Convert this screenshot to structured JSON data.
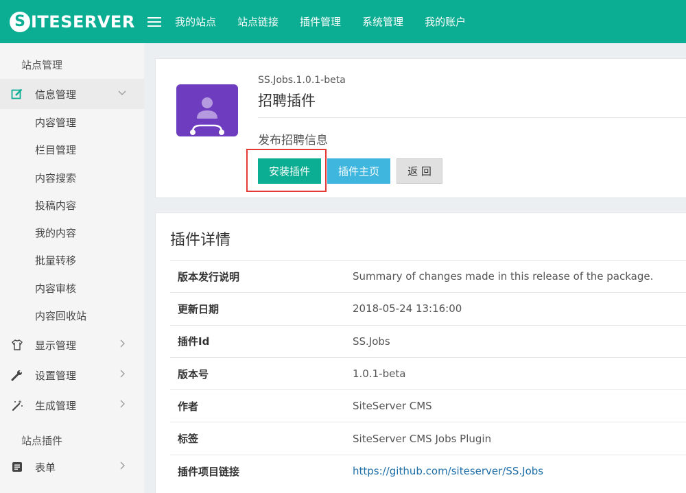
{
  "brand": {
    "logo_letter": "S",
    "logo_rest": "ITESERVER"
  },
  "topnav": [
    "我的站点",
    "站点链接",
    "插件管理",
    "系统管理",
    "我的账户"
  ],
  "sidebar": {
    "heading_site": "站点管理",
    "info_mgmt": "信息管理",
    "sub_items": [
      "内容管理",
      "栏目管理",
      "内容搜索",
      "投稿内容",
      "我的内容",
      "批量转移",
      "内容审核",
      "内容回收站"
    ],
    "display_mgmt": "显示管理",
    "settings_mgmt": "设置管理",
    "generate_mgmt": "生成管理",
    "heading_plugins": "站点插件",
    "form": "表单"
  },
  "plugin": {
    "id_version": "SS.Jobs.1.0.1-beta",
    "title": "招聘插件",
    "description": "发布招聘信息",
    "icon_color": "#6e3dbf",
    "buttons": {
      "install": "安装插件",
      "homepage": "插件主页",
      "back": "返 回"
    }
  },
  "details": {
    "title": "插件详情",
    "rows": [
      {
        "label": "版本发行说明",
        "value": "Summary of changes made in this release of the package."
      },
      {
        "label": "更新日期",
        "value": "2018-05-24 13:16:00"
      },
      {
        "label": "插件Id",
        "value": "SS.Jobs"
      },
      {
        "label": "版本号",
        "value": "1.0.1-beta"
      },
      {
        "label": "作者",
        "value": "SiteServer CMS"
      },
      {
        "label": "标签",
        "value": "SiteServer CMS Jobs Plugin"
      },
      {
        "label": "插件项目链接",
        "value": "https://github.com/siteserver/SS.Jobs"
      }
    ]
  },
  "colors": {
    "brand": "#0bae93",
    "info": "#3fb6dd",
    "highlight": "#e53935"
  }
}
